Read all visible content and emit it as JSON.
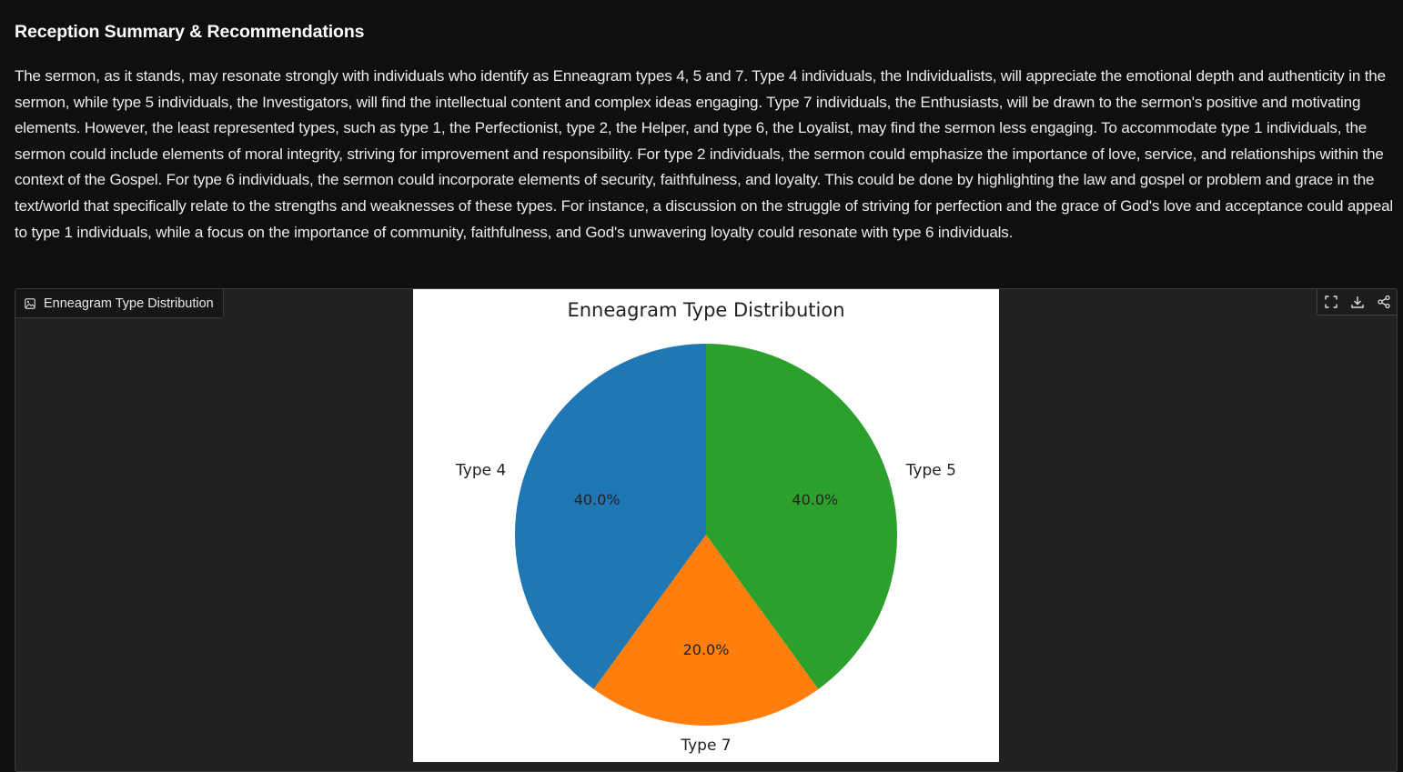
{
  "section": {
    "title": "Reception Summary & Recommendations",
    "body": "The sermon, as it stands, may resonate strongly with individuals who identify as Enneagram types 4, 5 and 7. Type 4 individuals, the Individualists, will appreciate the emotional depth and authenticity in the sermon, while type 5 individuals, the Investigators, will find the intellectual content and complex ideas engaging. Type 7 individuals, the Enthusiasts, will be drawn to the sermon's positive and motivating elements. However, the least represented types, such as type 1, the Perfectionist, type 2, the Helper, and type 6, the Loyalist, may find the sermon less engaging. To accommodate type 1 individuals, the sermon could include elements of moral integrity, striving for improvement and responsibility. For type 2 individuals, the sermon could emphasize the importance of love, service, and relationships within the context of the Gospel. For type 6 individuals, the sermon could incorporate elements of security, faithfulness, and loyalty. This could be done by highlighting the law and gospel or problem and grace in the text/world that specifically relate to the strengths and weaknesses of these types. For instance, a discussion on the struggle of striving for perfection and the grace of God's love and acceptance could appeal to type 1 individuals, while a focus on the importance of community, faithfulness, and God's unwavering loyalty could resonate with type 6 individuals."
  },
  "figure": {
    "label": "Enneagram Type Distribution",
    "label_icon": "image-icon",
    "toolbar": [
      {
        "icon": "fullscreen-icon"
      },
      {
        "icon": "download-icon"
      },
      {
        "icon": "share-icon"
      }
    ]
  },
  "chart_data": {
    "type": "pie",
    "title": "Enneagram Type Distribution",
    "start_angle_deg": 90,
    "direction": "counterclockwise",
    "slices": [
      {
        "label": "Type 4",
        "value": 40.0,
        "pct_label": "40.0%",
        "color": "#1f77b4"
      },
      {
        "label": "Type 7",
        "value": 20.0,
        "pct_label": "20.0%",
        "color": "#ff7f0e"
      },
      {
        "label": "Type 5",
        "value": 40.0,
        "pct_label": "40.0%",
        "color": "#2ca02c"
      }
    ]
  },
  "colors": {
    "background": "#0f0f11",
    "panel": "#212121",
    "text": "#ececec"
  }
}
